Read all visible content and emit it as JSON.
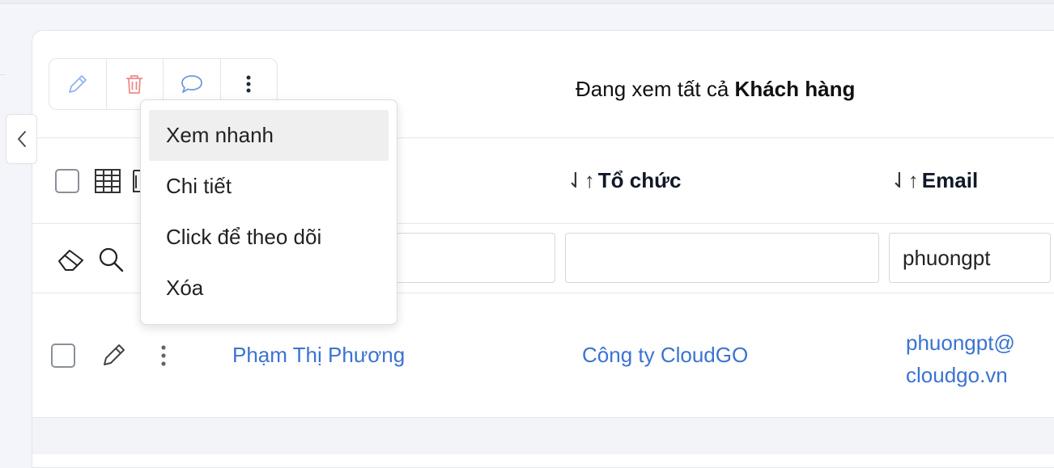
{
  "toolbar": {
    "edit_icon": "pencil-icon",
    "delete_icon": "trash-icon",
    "comment_icon": "comment-icon",
    "more_icon": "more-vertical-icon"
  },
  "view_title": {
    "prefix": "Đang xem tất cả",
    "module": "Khách hàng"
  },
  "dropdown_menu": {
    "items": [
      "Xem nhanh",
      "Chi tiết",
      "Click để theo dõi",
      "Xóa"
    ],
    "active_index": 0
  },
  "table": {
    "columns": [
      {
        "label": "Tổ chức",
        "sort_icon": "sort-icon"
      },
      {
        "label": "Email",
        "sort_icon": "sort-icon"
      }
    ],
    "sort_glyph": "⇃↑",
    "filters": {
      "name": "",
      "organization": "",
      "email": "phuongpt"
    },
    "rows": [
      {
        "name": "Phạm Thị Phương",
        "organization": "Công ty CloudGO",
        "email_line1": "phuongpt@",
        "email_line2": "cloudgo.vn"
      }
    ]
  },
  "colors": {
    "link": "#3b73d1",
    "edit_icon": "#90b4ea",
    "delete_icon": "#ef8a8a",
    "comment_icon": "#6f9be0"
  }
}
